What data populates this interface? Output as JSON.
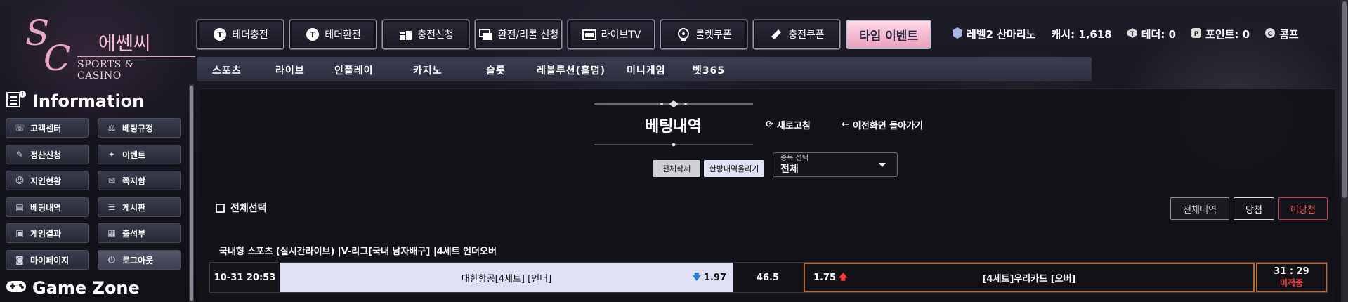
{
  "logo": {
    "mono_s": "S",
    "mono_c": "C",
    "korean": "에쎈씨",
    "english": "SPORTS & CASINO"
  },
  "top_buttons": [
    {
      "label": "테더충전",
      "icon": "tether-deposit-icon"
    },
    {
      "label": "테더환전",
      "icon": "tether-exchange-icon"
    },
    {
      "label": "충전신청",
      "icon": "coins-icon"
    },
    {
      "label": "환전/리롤 신청",
      "icon": "exchange-icon"
    },
    {
      "label": "라이브TV",
      "icon": "live-tv-icon"
    },
    {
      "label": "룰렛쿠폰",
      "icon": "roulette-icon"
    },
    {
      "label": "충전쿠폰",
      "icon": "ticket-icon"
    }
  ],
  "event_button": "타임 이벤트",
  "user": {
    "level": "레벨2 산마리노",
    "cash": "캐시: 1,618",
    "tether": "테더: 0",
    "points": "포인트: 0",
    "comp": "콤프"
  },
  "subnav": [
    "스포츠",
    "라이브",
    "인플레이",
    "카지노",
    "슬롯",
    "레볼루션(홀덤)",
    "미니게임",
    "벳365"
  ],
  "sidebar": {
    "info_title": "Information",
    "game_title": "Game Zone",
    "items": [
      {
        "label": "고객센터",
        "icon": "headset-icon"
      },
      {
        "label": "베팅규정",
        "icon": "gavel-icon"
      },
      {
        "label": "정산신청",
        "icon": "settlement-icon"
      },
      {
        "label": "이벤트",
        "icon": "event-icon"
      },
      {
        "label": "지인현황",
        "icon": "friends-icon"
      },
      {
        "label": "쪽지함",
        "icon": "message-icon"
      },
      {
        "label": "베팅내역",
        "icon": "betting-history-icon"
      },
      {
        "label": "게시판",
        "icon": "board-icon"
      },
      {
        "label": "게임결과",
        "icon": "game-result-icon"
      },
      {
        "label": "출석부",
        "icon": "attendance-icon"
      },
      {
        "label": "마이페이지",
        "icon": "user-icon"
      },
      {
        "label": "로그아웃",
        "icon": "power-icon"
      }
    ]
  },
  "page": {
    "title": "베팅내역",
    "refresh": "새로고침",
    "go_back": "이전화면 돌아가기",
    "delete_all": "전체삭제",
    "upload_all": "한방내역올리기",
    "select_label": "종목 선택",
    "select_value": "전체",
    "select_all": "전체선택",
    "filters": {
      "all": "전체내역",
      "win": "당첨",
      "lose": "미당첨"
    }
  },
  "bet": {
    "header": "국내형 스포츠 (실시간라이브) |V-리그[국내 남자배구] |4세트 언더오버",
    "date": "10-31 20:53",
    "home_name": "대한항공[4세트] [언더]",
    "home_odds": "1.97",
    "line": "46.5",
    "away_odds": "1.75",
    "away_name": "[4세트]우리카드 [오버]",
    "score": "31 : 29",
    "status": "미적중"
  },
  "colors": {
    "accent_pink": "#e8a3bd",
    "status_red": "#ff3b3b",
    "highlight_orange": "#b06a3a"
  }
}
